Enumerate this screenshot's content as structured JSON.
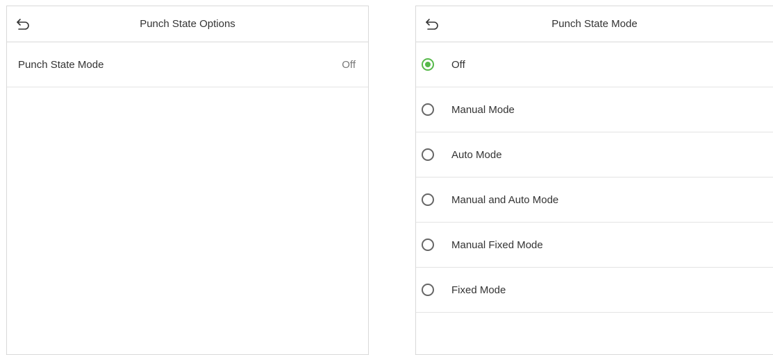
{
  "left_screen": {
    "title": "Punch State Options",
    "back_icon": "back-arrow-icon",
    "rows": [
      {
        "label": "Punch State Mode",
        "value": "Off"
      }
    ]
  },
  "right_screen": {
    "title": "Punch State Mode",
    "back_icon": "back-arrow-icon",
    "selected_index": 0,
    "options": [
      {
        "label": "Off",
        "selected": true
      },
      {
        "label": "Manual Mode",
        "selected": false
      },
      {
        "label": "Auto Mode",
        "selected": false
      },
      {
        "label": "Manual and Auto Mode",
        "selected": false
      },
      {
        "label": "Manual Fixed Mode",
        "selected": false
      },
      {
        "label": "Fixed Mode",
        "selected": false
      }
    ]
  },
  "colors": {
    "accent": "#56b94a",
    "border": "#d9d9d9",
    "text": "#333333"
  }
}
